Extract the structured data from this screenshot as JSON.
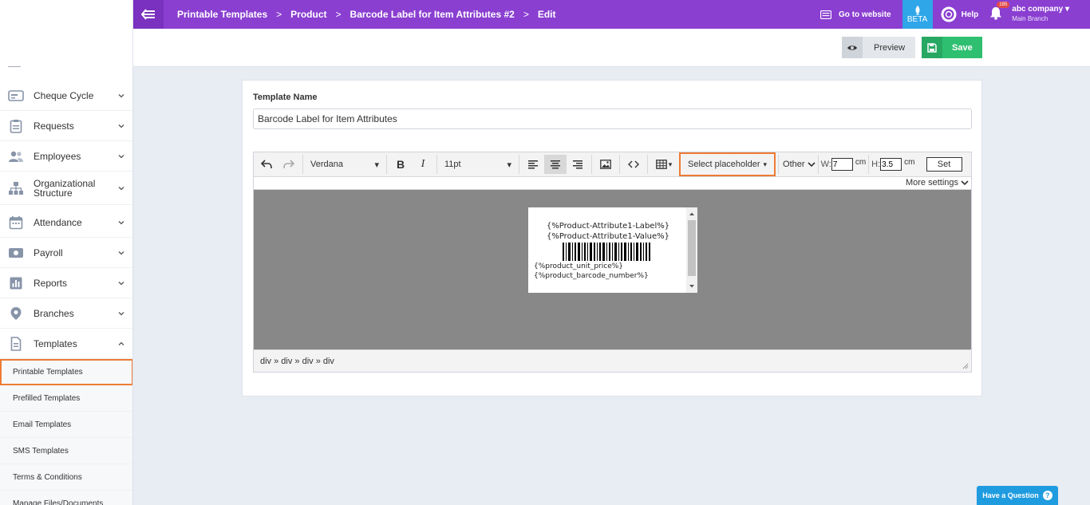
{
  "topbar": {
    "breadcrumbs": [
      "Printable Templates",
      "Product",
      "Barcode Label for Item Attributes #2",
      "Edit"
    ],
    "separator": ">",
    "go_to_website": "Go to website",
    "beta": "BETA",
    "help": "Help",
    "notification_count": "185",
    "company": "abc company",
    "branch": "Main Branch",
    "accent_color": "#8a3fd1"
  },
  "sidebar": {
    "items": [
      {
        "label": "Cheque Cycle",
        "icon": "cheque-icon"
      },
      {
        "label": "Requests",
        "icon": "clipboard-icon"
      },
      {
        "label": "Employees",
        "icon": "users-icon"
      },
      {
        "label": "Organizational Structure",
        "icon": "org-chart-icon"
      },
      {
        "label": "Attendance",
        "icon": "calendar-icon"
      },
      {
        "label": "Payroll",
        "icon": "money-icon"
      },
      {
        "label": "Reports",
        "icon": "bar-chart-icon"
      },
      {
        "label": "Branches",
        "icon": "location-pin-icon"
      },
      {
        "label": "Templates",
        "icon": "document-icon"
      }
    ],
    "sub_items": [
      "Printable Templates",
      "Prefilled Templates",
      "Email Templates",
      "SMS Templates",
      "Terms & Conditions",
      "Manage Files/Documents"
    ]
  },
  "actions": {
    "preview": "Preview",
    "save": "Save"
  },
  "form": {
    "template_name_label": "Template Name",
    "template_name_value": "Barcode Label for Item Attributes"
  },
  "editor": {
    "font_family": "Verdana",
    "font_size": "11pt",
    "placeholder_btn": "Select placeholder",
    "other": "Other",
    "w_label": "W:",
    "w_value": "7",
    "h_label": "H:",
    "h_value": "3.5",
    "unit": "cm",
    "set": "Set",
    "more_settings": "More settings",
    "path": "div » div » div » div",
    "label_lines": [
      "{%Product-Attribute1-Label%}",
      "{%Product-Attribute1-Value%}",
      "{%product_unit_price%}",
      "{%product_barcode_number%}"
    ]
  },
  "help_widget": {
    "text": "Have a Question",
    "icon": "?"
  }
}
